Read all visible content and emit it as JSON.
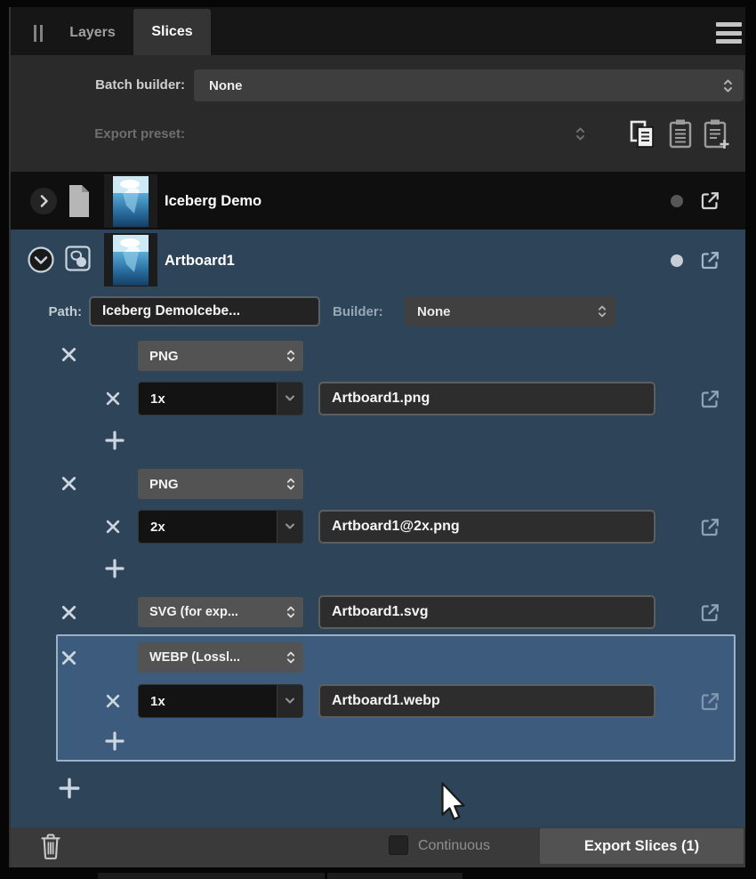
{
  "panel": {
    "tabs": {
      "layers": "Layers",
      "slices": "Slices"
    },
    "batch_builder": {
      "label": "Batch builder:",
      "value": "None"
    },
    "export_preset": {
      "label": "Export preset:"
    },
    "document": {
      "title": "Iceberg Demo"
    },
    "artboard": {
      "title": "Artboard1",
      "path_label": "Path:",
      "path_value": "Iceberg DemoIcebe...",
      "builder_label": "Builder:",
      "builder_value": "None"
    },
    "export_groups": [
      {
        "format": "PNG",
        "scale": "1x",
        "filename": "Artboard1.png"
      },
      {
        "format": "PNG",
        "scale": "2x",
        "filename": "Artboard1@2x.png"
      },
      {
        "format": "SVG (for exp...",
        "filename": "Artboard1.svg"
      },
      {
        "format": "WEBP (Lossl...",
        "scale": "1x",
        "filename": "Artboard1.webp"
      }
    ],
    "footer": {
      "continuous": "Continuous",
      "export_button": "Export Slices (1)"
    },
    "colors": {
      "selection_blue": "#2e4459",
      "highlight_blue": "#3d5b7d",
      "panel_gray": "#2a2a2a",
      "row_black": "#0f0f0f",
      "bar_gray": "#3a3a3a"
    }
  }
}
